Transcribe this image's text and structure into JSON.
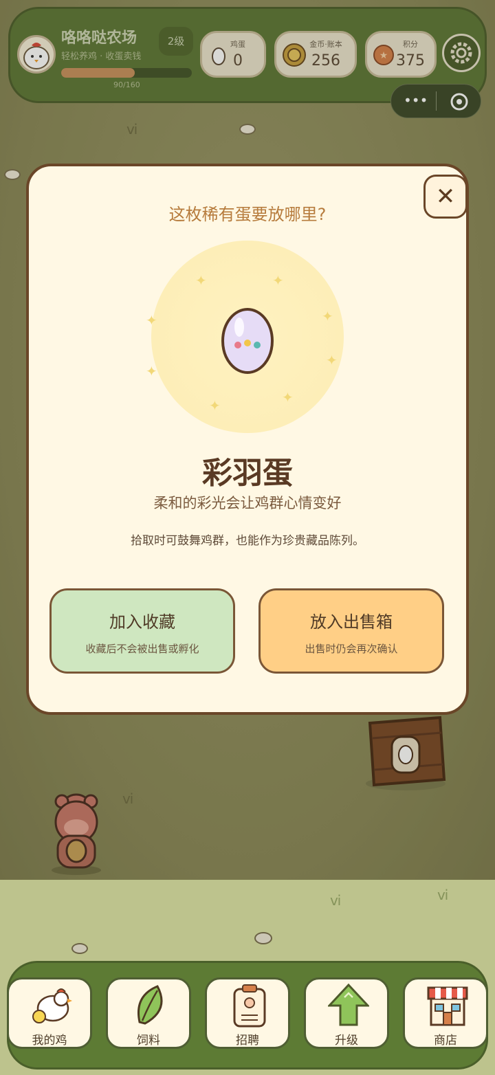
{
  "header": {
    "farm_name": "咯咯哒农场",
    "farm_sub": "轻松养鸡 · 收蛋卖钱",
    "level": "2级",
    "xp_text": "90/160",
    "xp_fraction": 0.5625,
    "stats": [
      {
        "label": "鸡蛋",
        "value": "0",
        "icon": "egg-icon"
      },
      {
        "label": "金币·账本",
        "value": "256",
        "icon": "coin-icon"
      },
      {
        "label": "积分",
        "value": "375",
        "icon": "star-icon"
      }
    ]
  },
  "modal": {
    "question": "这枚稀有蛋要放哪里?",
    "close_label": "✕",
    "egg_name": "彩羽蛋",
    "egg_desc": "柔和的彩光会让鸡群心情变好",
    "egg_note": "拾取时可鼓舞鸡群，也能作为珍贵藏品陈列。",
    "collect": {
      "title": "加入收藏",
      "sub": "收藏后不会被出售或孵化"
    },
    "sell": {
      "title": "放入出售箱",
      "sub": "出售时仍会再次确认"
    }
  },
  "nav": [
    {
      "label": "我的鸡",
      "icon": "chicken-icon"
    },
    {
      "label": "饲料",
      "icon": "leaf-icon"
    },
    {
      "label": "招聘",
      "icon": "badge-icon"
    },
    {
      "label": "升级",
      "icon": "up-arrow-icon"
    },
    {
      "label": "商店",
      "icon": "shop-icon"
    }
  ],
  "colors": {
    "header_green": "#5f7838",
    "modal_bg": "#fff8e4",
    "collect_green": "#cfe7c0",
    "sell_orange": "#ffcf86",
    "egg_lavender": "#e6dcf6"
  }
}
